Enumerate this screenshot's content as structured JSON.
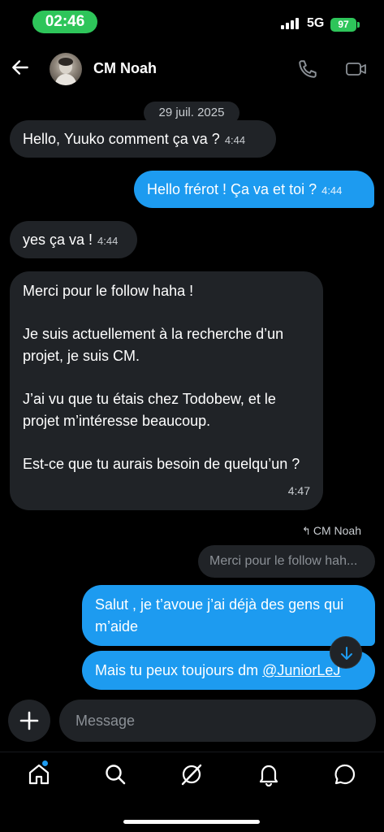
{
  "status_bar": {
    "time": "02:46",
    "network": "5G",
    "battery": "97"
  },
  "header": {
    "contact_name": "CM Noah"
  },
  "conversation": {
    "date_separator": "29 juil. 2025",
    "messages": [
      {
        "direction": "incoming",
        "text": "Hello, Yuuko comment ça va ?",
        "time": "4:44"
      },
      {
        "direction": "outgoing",
        "text": "Hello frérot !  Ça va et toi ?",
        "time": "4:44"
      },
      {
        "direction": "incoming",
        "text": "yes ça va !",
        "time": "4:44"
      },
      {
        "direction": "incoming",
        "paragraphs": [
          "Merci pour le follow haha !",
          "Je suis actuellement à la recherche d’un projet, je suis CM.",
          "J’ai vu que tu étais chez Todobew, et le projet m’intéresse beaucoup.",
          "Est-ce que tu aurais besoin de quelqu’un ?"
        ],
        "time": "4:47"
      }
    ],
    "reply": {
      "label": "CM Noah",
      "quoted_text": "Merci pour le follow hah..."
    },
    "outgoing_reply": {
      "text": "Salut , je t’avoue j’ai déjà des gens qui m’aide"
    },
    "outgoing_last": {
      "text": "Mais tu peux toujours dm ",
      "mention": "@JuniorLeJ"
    }
  },
  "composer": {
    "placeholder": "Message"
  },
  "colors": {
    "accent": "#1d9bf0",
    "incoming_bubble": "#202327",
    "background": "#000000",
    "status_green": "#2ec55a"
  },
  "nav": {
    "items": [
      "home-icon",
      "search-icon",
      "grok-icon",
      "notifications-icon",
      "messages-icon"
    ]
  }
}
